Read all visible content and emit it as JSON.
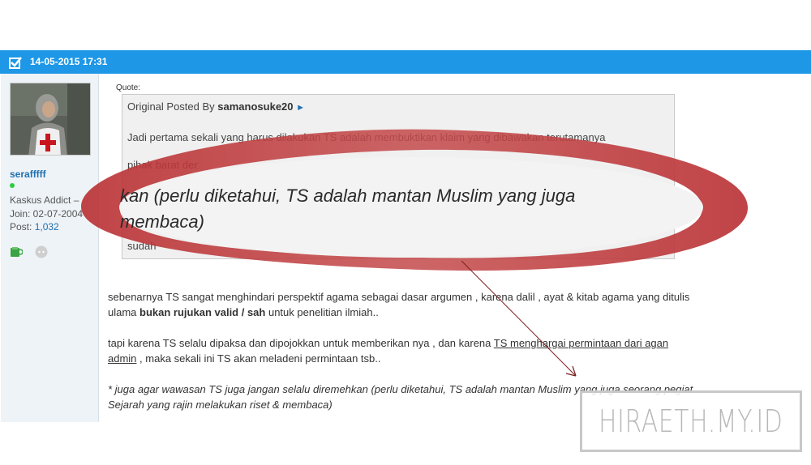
{
  "post": {
    "date": "14-05-2015 17:31"
  },
  "user": {
    "name": "serafffff",
    "level": "Kaskus Addict –",
    "join": "Join: 02-07-2004",
    "post_label": "Post: ",
    "post_count": "1,032"
  },
  "quote": {
    "label": "Quote:",
    "posted_by_prefix": "Original Posted By ",
    "author": "samanosuke20",
    "author_arrow": "►",
    "line1": "Jadi pertama sekali yang harus dilakukan TS adalah membuktikan klaim yang dibawakan terutamanya",
    "line2": "pihak barat der",
    "line3": "sudah"
  },
  "zoom": {
    "line1": "kan (perlu diketahui, TS adalah mantan Muslim yang juga",
    "line2": "membaca)"
  },
  "body": {
    "p1_a": "sebenarnya TS sangat menghindari perspektif agama sebagai dasar argumen , karena dalil , ayat & kitab agama yang ditulis ulama ",
    "p1_bold": "bukan rujukan valid / sah",
    "p1_b": " untuk penelitian ilmiah..",
    "p2_a": "tapi karena TS selalu dipaksa dan dipojokkan untuk memberikan nya , dan karena ",
    "p2_link": "TS menghargai permintaan dari agan admin",
    "p2_b": " , maka sekali ini TS akan meladeni permintaan tsb..",
    "p3": "* juga agar wawasan TS juga jangan selalu diremehkan (perlu diketahui, TS adalah mantan Muslim yang juga seorang pegiat Sejarah yang rajin melakukan riset & membaca)"
  },
  "watermark": "HIRAETH.MY.ID",
  "colors": {
    "header": "#1e97e6",
    "highlight_ellipse": "#b92f32",
    "link": "#1e6fb0"
  }
}
